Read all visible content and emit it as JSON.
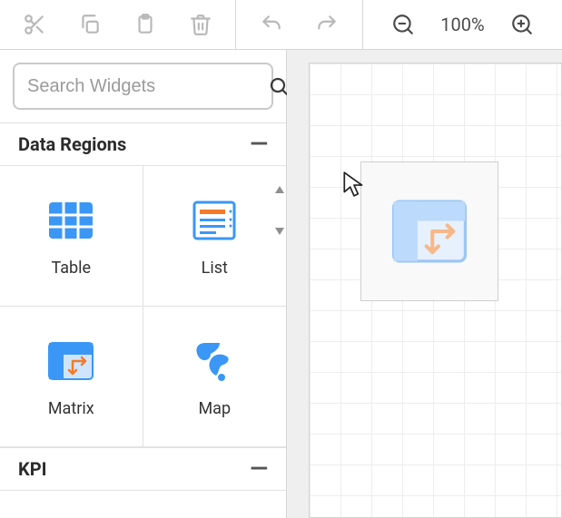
{
  "toolbar": {
    "zoom_level": "100%"
  },
  "sidebar": {
    "search_placeholder": "Search Widgets",
    "sections": {
      "data_regions": {
        "title": "Data Regions",
        "widgets": [
          {
            "label": "Table"
          },
          {
            "label": "List"
          },
          {
            "label": "Matrix"
          },
          {
            "label": "Map"
          }
        ]
      },
      "kpi": {
        "title": "KPI"
      }
    }
  },
  "canvas": {
    "dragging_widget": "Matrix"
  }
}
